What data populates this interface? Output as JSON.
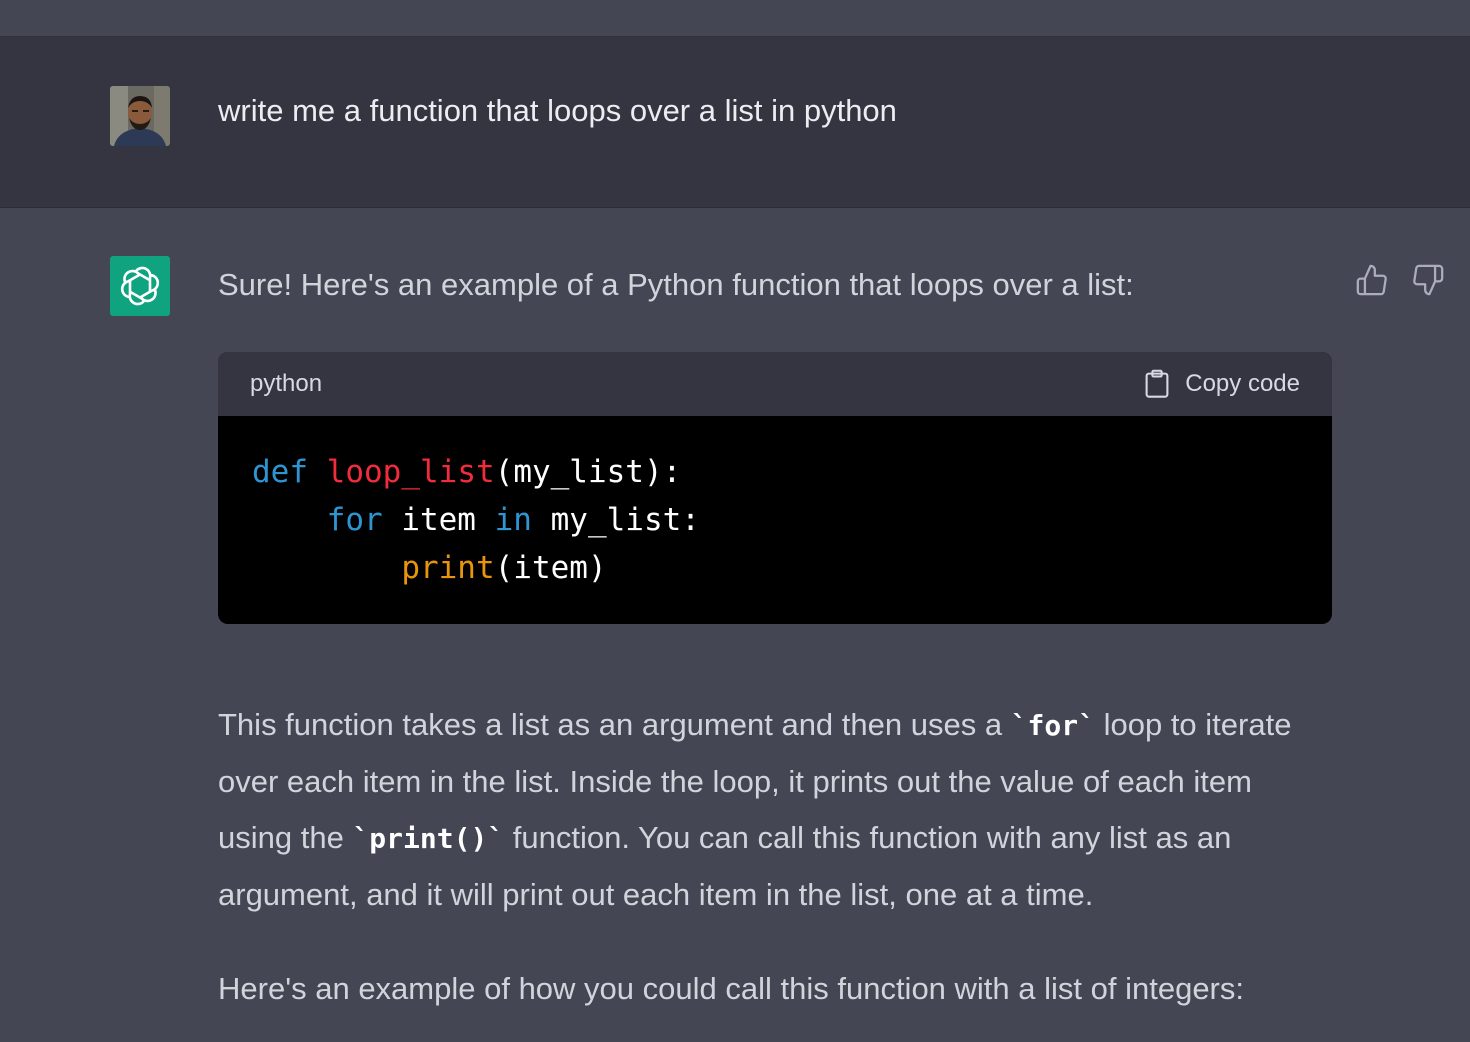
{
  "user_message": {
    "text": "write me a function that loops over a list in python"
  },
  "assistant": {
    "intro": "Sure! Here's an example of a Python function that loops over a list:",
    "code_block": {
      "language": "python",
      "copy_label": "Copy code",
      "lines": [
        [
          {
            "t": "def",
            "c": "kw"
          },
          {
            "t": " "
          },
          {
            "t": "loop_list",
            "c": "fn"
          },
          {
            "t": "(my_list):"
          }
        ],
        [
          {
            "t": "    "
          },
          {
            "t": "for",
            "c": "kw"
          },
          {
            "t": " item "
          },
          {
            "t": "in",
            "c": "kw"
          },
          {
            "t": " my_list:"
          }
        ],
        [
          {
            "t": "        "
          },
          {
            "t": "print",
            "c": "bi"
          },
          {
            "t": "(item)"
          }
        ]
      ]
    },
    "paragraph1": {
      "p1": "This function takes a list as an argument and then uses a ",
      "code1": "`for`",
      "p2": " loop to iterate over each item in the list. Inside the loop, it prints out the value of each item using the ",
      "code2": "`print()`",
      "p3": " function. You can call this function with any list as an argument, and it will print out each item in the list, one at a time."
    },
    "paragraph2": "Here's an example of how you could call this function with a list of integers:"
  },
  "colors": {
    "assistant_bg": "#444654",
    "user_bg": "#343541",
    "bot_avatar": "#10A37F",
    "keyword": "#2E95D3",
    "function_name": "#F22C3D",
    "builtin": "#E9950C"
  },
  "icons": {
    "user_avatar": "user-photo-avatar",
    "bot_avatar": "openai-logo-icon",
    "like": "thumbs-up-icon",
    "dislike": "thumbs-down-icon",
    "copy": "clipboard-icon"
  }
}
